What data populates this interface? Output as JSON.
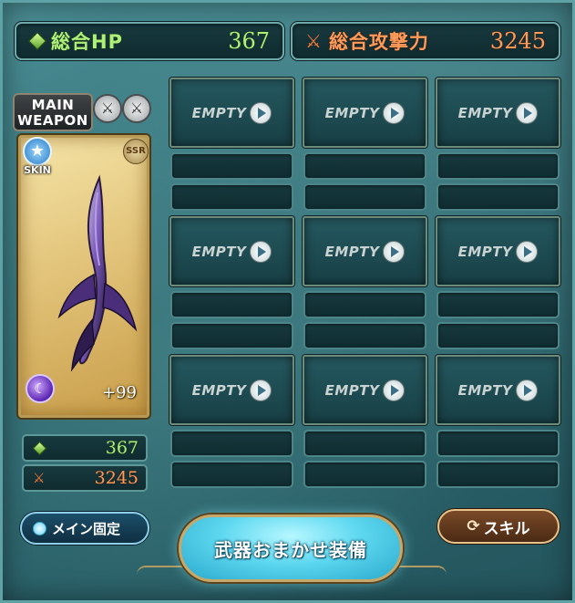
{
  "header": {
    "hp_label": "総合HP",
    "hp_value": "367",
    "atk_label": "総合攻撃力",
    "atk_value": "3245"
  },
  "main_weapon": {
    "label_line1": "MAIN",
    "label_line2": "WEAPON",
    "skin_label": "SKIN",
    "rarity": "SSR",
    "plus": "+99",
    "hp": "367",
    "atk": "3245"
  },
  "grid": {
    "empty_label": "EMPTY"
  },
  "buttons": {
    "main_fixed": "メイン固定",
    "auto_equip": "武器おまかせ装備",
    "skill": "スキル"
  },
  "colors": {
    "hp": "#aef07a",
    "atk": "#ff9b5a",
    "frame": "#5fa2a6"
  }
}
